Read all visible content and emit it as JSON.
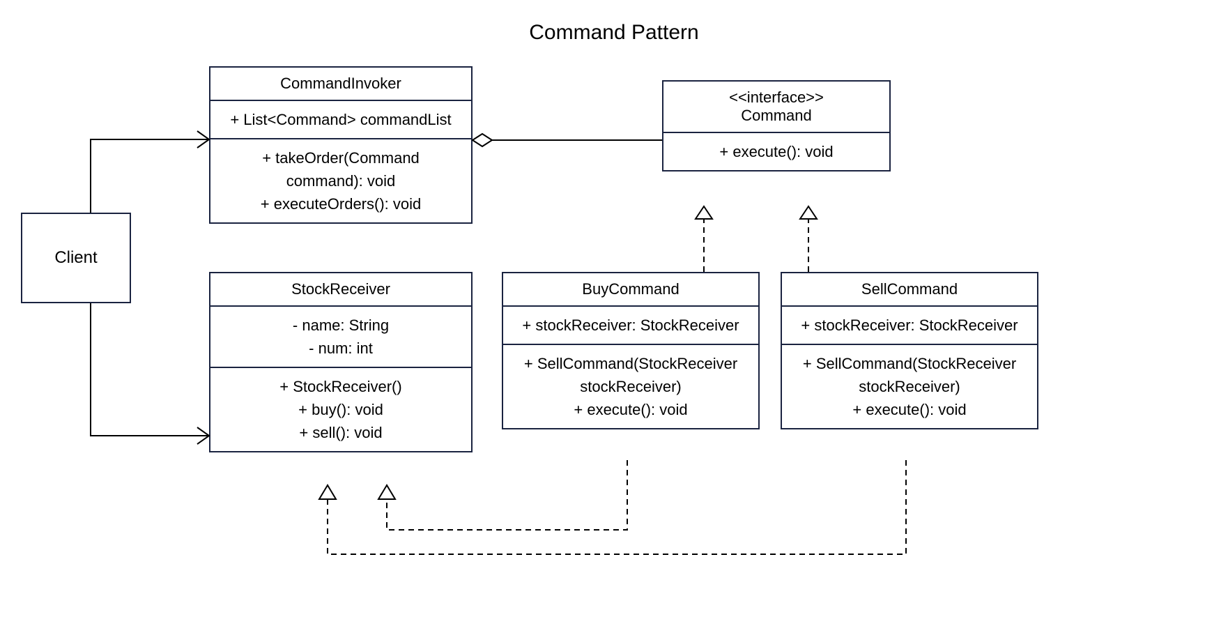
{
  "title": "Command Pattern",
  "client": {
    "name": "Client"
  },
  "commandInvoker": {
    "name": "CommandInvoker",
    "attr1": "+ List<Command> commandList",
    "op1": "+  takeOrder(Command",
    "op1b": "command): void",
    "op2": "+ executeOrders(): void"
  },
  "command": {
    "stereotype": "<<interface>>",
    "name": "Command",
    "op1": "+    execute(): void"
  },
  "stockReceiver": {
    "name": "StockReceiver",
    "attr1": "- name: String",
    "attr2": "- num: int",
    "op1": "+  StockReceiver()",
    "op2": "+  buy(): void",
    "op3": "+  sell(): void"
  },
  "buyCommand": {
    "name": "BuyCommand",
    "attr1": "+   stockReceiver: StockReceiver",
    "op1": "+   SellCommand(StockReceiver",
    "op1b": "stockReceiver)",
    "op2": "+    execute(): void"
  },
  "sellCommand": {
    "name": "SellCommand",
    "attr1": "+   stockReceiver: StockReceiver",
    "op1": "+   SellCommand(StockReceiver",
    "op1b": "stockReceiver)",
    "op2": "+    execute(): void"
  }
}
